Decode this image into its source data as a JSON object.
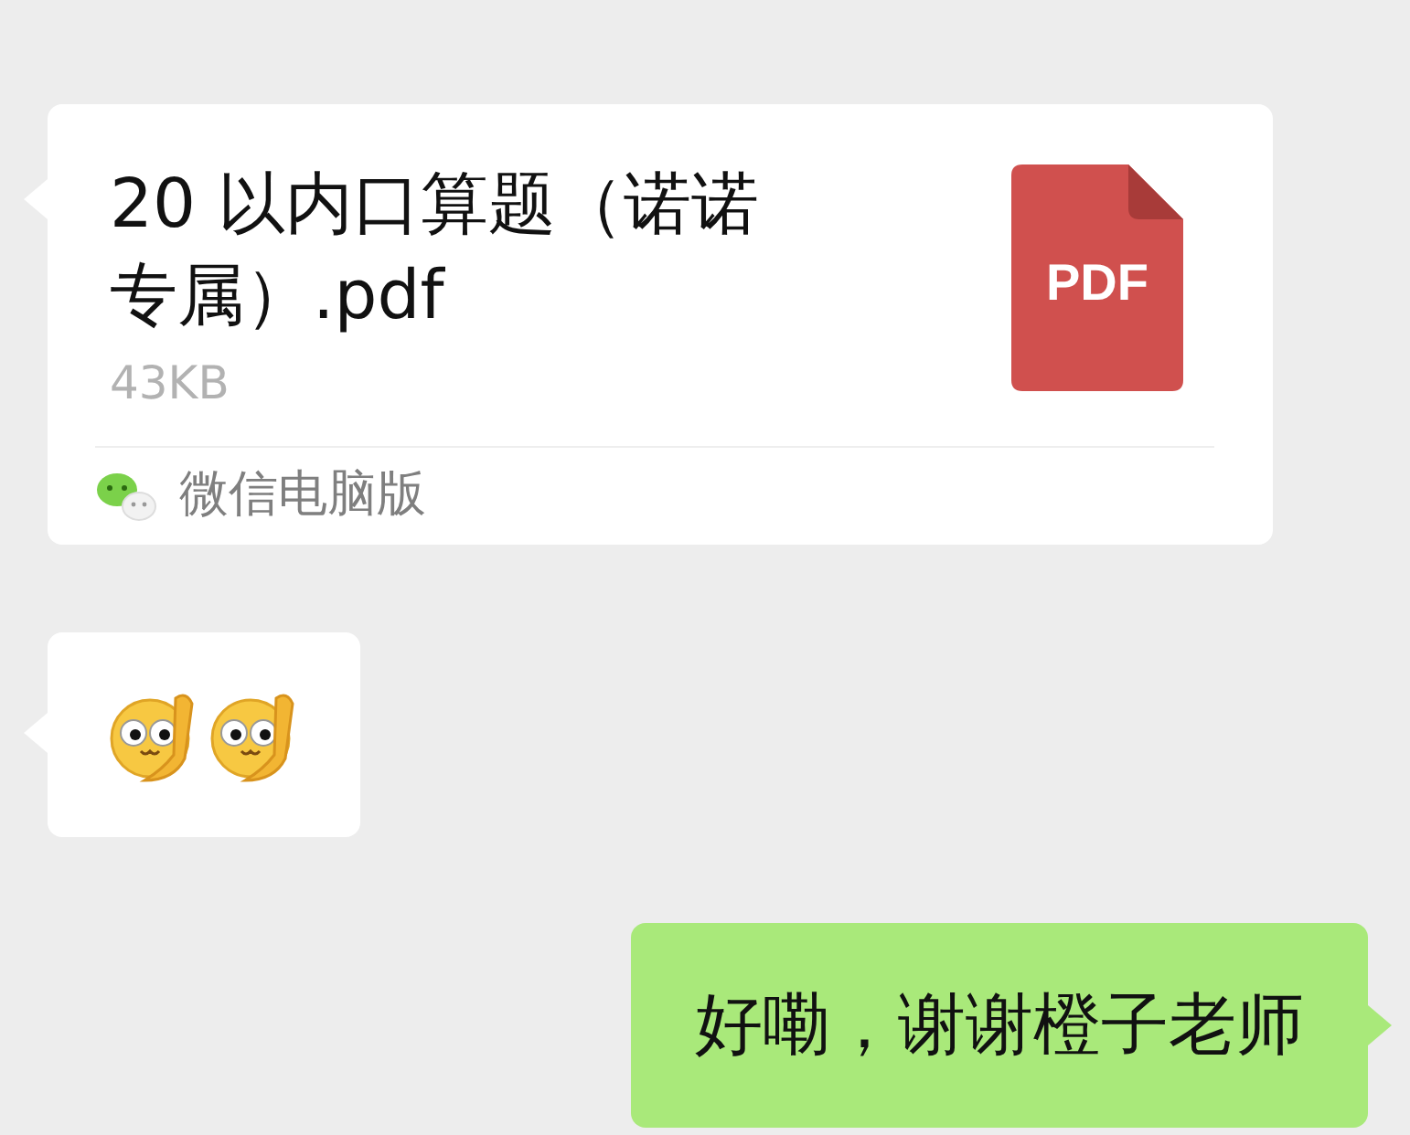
{
  "messages": [
    {
      "kind": "file",
      "sent": false,
      "title": "20 以内口算题（诺诺专属）.pdf",
      "size": "43KB",
      "file_type": "PDF",
      "source": "微信电脑版"
    },
    {
      "kind": "emoji",
      "sent": false,
      "emojis": [
        {
          "kind": "thinking"
        },
        {
          "kind": "thinking"
        }
      ]
    },
    {
      "kind": "text",
      "sent": true,
      "text": "好嘞，谢谢橙子老师"
    }
  ]
}
